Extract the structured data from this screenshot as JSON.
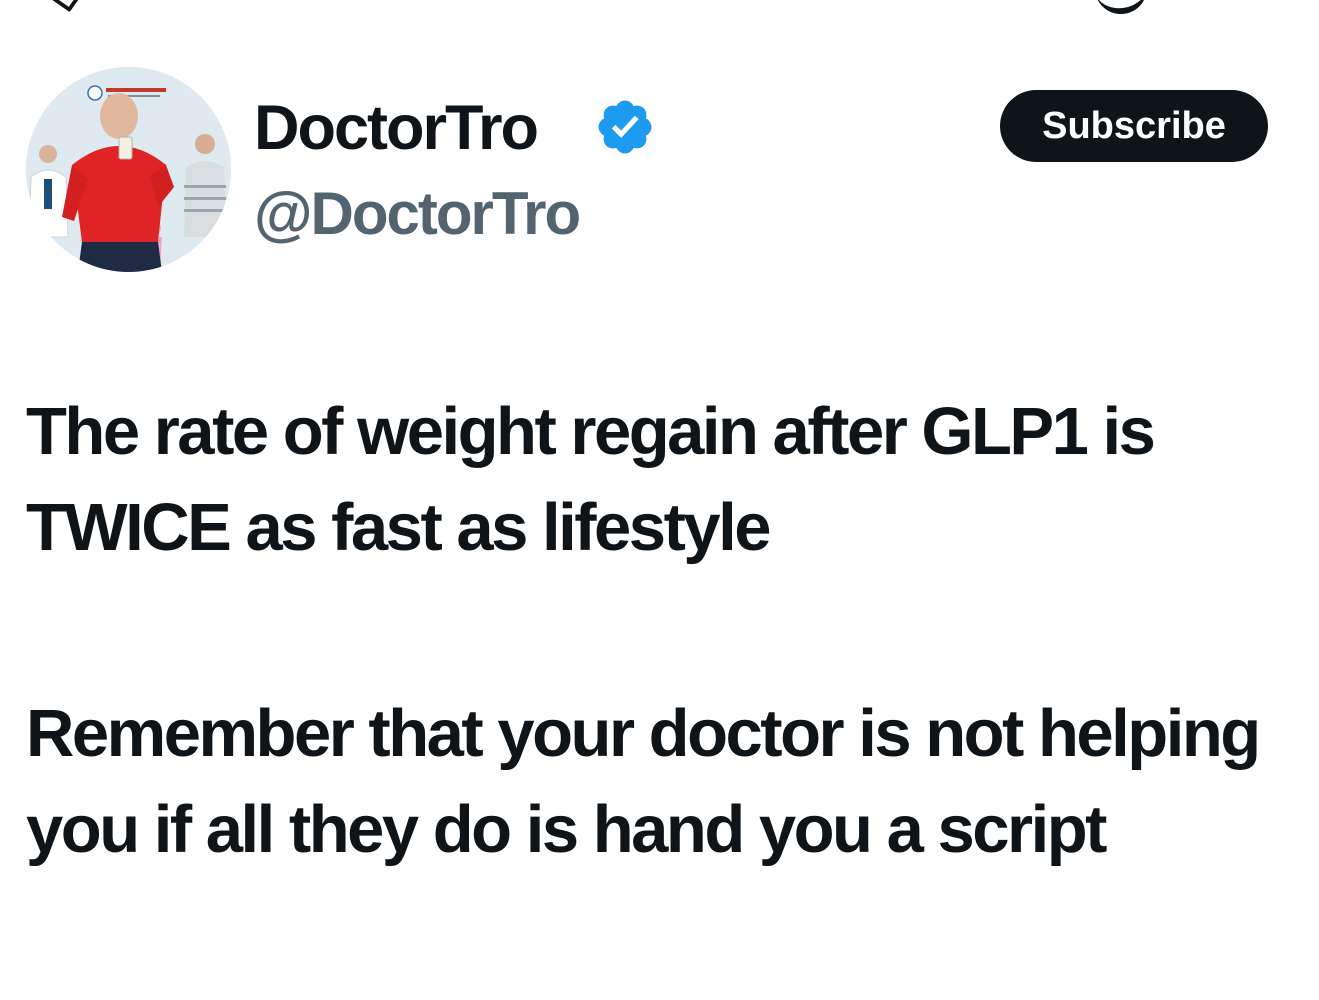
{
  "author": {
    "display_name": "DoctorTro",
    "handle": "@DoctorTro",
    "verified": true,
    "avatar_icon": "profile-photo-avatar",
    "badge_icon": "verified-badge-icon",
    "badge_color": "#1d9bf0"
  },
  "actions": {
    "subscribe_label": "Subscribe"
  },
  "tweet": {
    "paragraphs": [
      "The rate of weight regain after GLP1 is TWICE as fast as lifestyle",
      "Remember that your doctor is not helping you if all they do is hand you a script"
    ]
  },
  "colors": {
    "text_primary": "#0f1419",
    "text_secondary": "#536471",
    "button_bg": "#0f1419",
    "button_text": "#ffffff",
    "background": "#ffffff"
  }
}
